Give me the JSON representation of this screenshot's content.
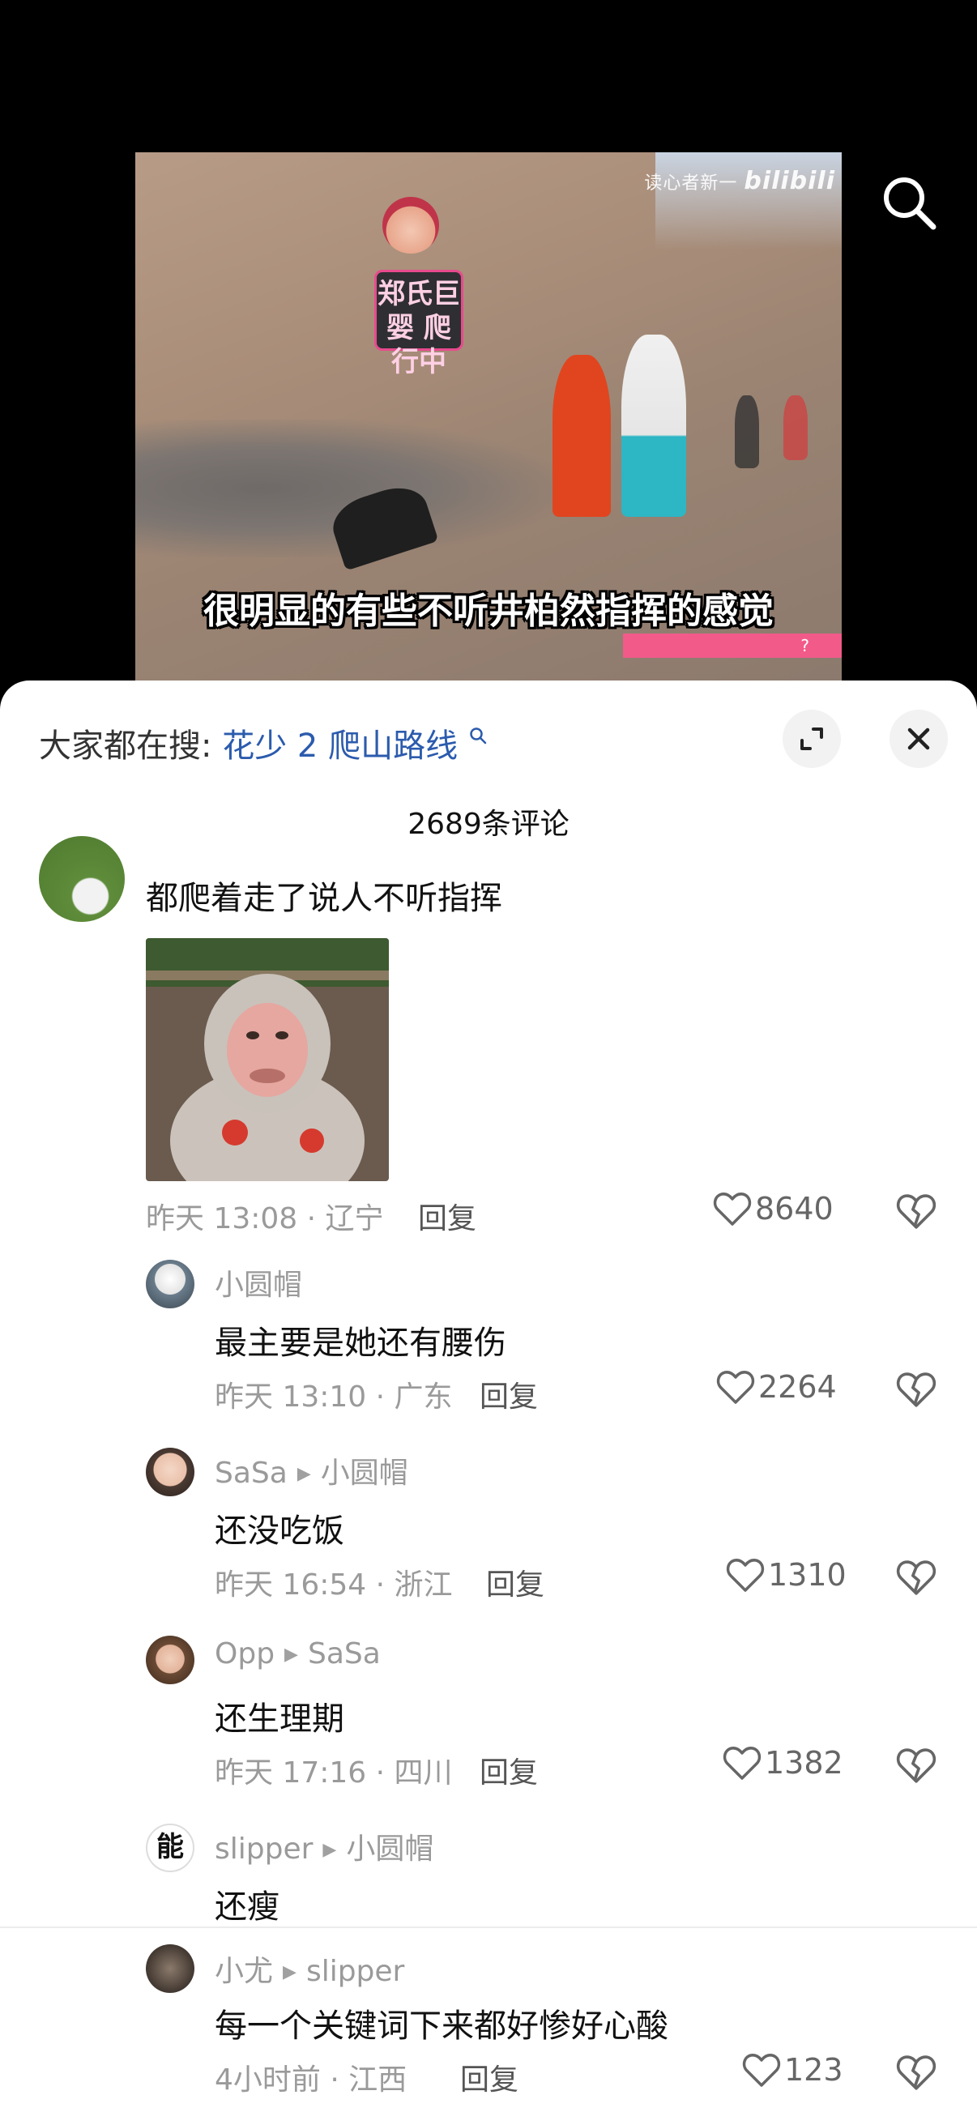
{
  "video": {
    "watermark_text": "读心者新一",
    "watermark_brand": "bilibili",
    "sticker_text": "郑氏巨婴 爬行中",
    "subtitle": "很明显的有些不听井柏然指挥的感觉",
    "pink_bar_text": "?"
  },
  "search_icon": "search-icon",
  "sheet": {
    "hot_search_prefix": "大家都在搜:",
    "hot_search_term": "花少 2 爬山路线",
    "comment_count": "2689条评论",
    "colors": {
      "link": "#2b5bad",
      "meta": "#9a9a9a"
    }
  },
  "comments": [
    {
      "text": "都爬着走了说人不听指挥",
      "meta": "昨天 13:08 · 辽宁",
      "reply": "回复",
      "likes": "8640"
    },
    {
      "user": "小圆帽",
      "text": "最主要是她还有腰伤",
      "meta": "昨天 13:10 · 广东",
      "reply": "回复",
      "likes": "2264"
    },
    {
      "user": "SaSa",
      "reply_to": "小圆帽",
      "text": "还没吃饭",
      "meta": "昨天 16:54 · 浙江",
      "reply": "回复",
      "likes": "1310"
    },
    {
      "user": "Opp",
      "reply_to": "SaSa",
      "text": "还生理期",
      "meta": "昨天 17:16 · 四川",
      "reply": "回复",
      "likes": "1382"
    },
    {
      "user": "slipper",
      "reply_to": "小圆帽",
      "text": "还瘦",
      "avatar_char": "能"
    },
    {
      "user": "小尤",
      "reply_to": "slipper",
      "text": "每一个关键词下来都好惨好心酸",
      "meta": "4小时前 · 江西",
      "reply": "回复",
      "likes": "123"
    }
  ]
}
